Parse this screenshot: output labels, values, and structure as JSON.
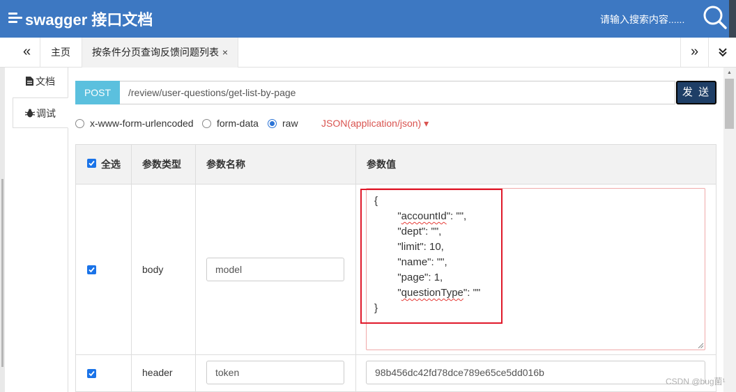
{
  "header": {
    "title": "swagger 接口文档",
    "search_placeholder": "请输入搜索内容......"
  },
  "tabs": {
    "prev_glyph": "«",
    "home_label": "主页",
    "active_label": "按条件分页查询反馈问题列表",
    "close_glyph": "×",
    "next_glyph": "»",
    "menu_glyph": "⌄"
  },
  "sidebar": {
    "doc_label": "文档",
    "debug_label": "调试"
  },
  "request": {
    "method": "POST",
    "url": "/review/user-questions/get-list-by-page",
    "send_label": "发 送"
  },
  "body_type": {
    "options": [
      "x-www-form-urlencoded",
      "form-data",
      "raw"
    ],
    "selected": "raw",
    "content_type": "JSON(application/json)",
    "content_type_caret": "▾"
  },
  "params_table": {
    "headers": {
      "select_all": "全选",
      "param_type": "参数类型",
      "param_name": "参数名称",
      "param_value": "参数值"
    },
    "rows": [
      {
        "checked": true,
        "type": "body",
        "name": "model",
        "value_lines": [
          "{",
          "        \"accountId\": \"\",",
          "        \"dept\": \"\",",
          "        \"limit\": 10,",
          "        \"name\": \"\",",
          "        \"page\": 1,",
          "        \"questionType\": \"\"",
          "}"
        ]
      },
      {
        "checked": true,
        "type": "header",
        "name": "token",
        "value": "98b456dc42fd78dce789e65ce5dd016b"
      }
    ]
  },
  "watermark": "CSDN @bug菌¹",
  "colors": {
    "header_bg": "#3d78c2",
    "method_bg": "#5bc0de",
    "send_bg": "#1e3e66",
    "content_type": "#d9534f",
    "highlight_box": "#e0182a",
    "checkbox": "#1a73e8"
  }
}
